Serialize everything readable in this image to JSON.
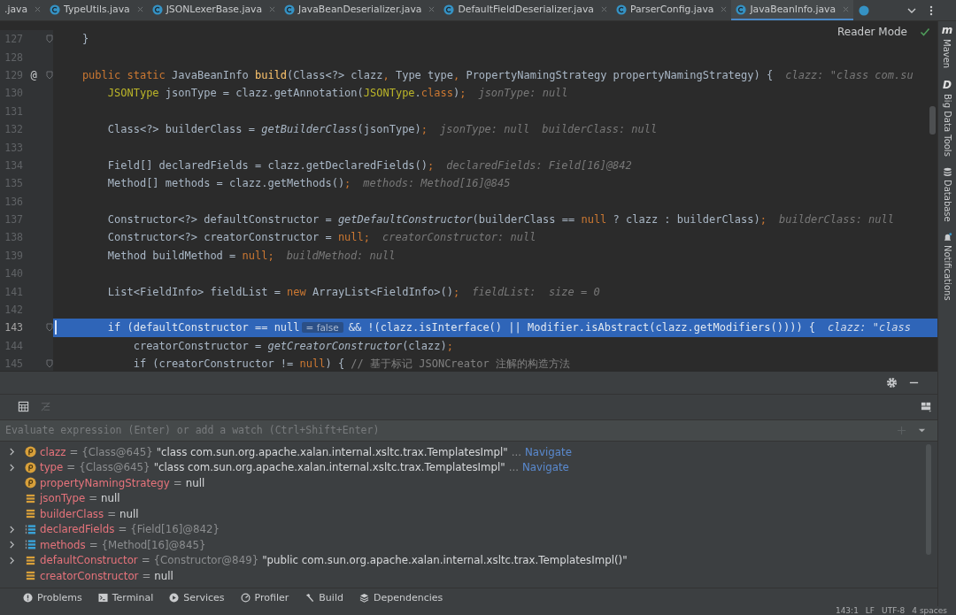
{
  "tabs": [
    {
      "label": ".java",
      "selected": false
    },
    {
      "label": "TypeUtils.java",
      "selected": false
    },
    {
      "label": "JSONLexerBase.java",
      "selected": false
    },
    {
      "label": "JavaBeanDeserializer.java",
      "selected": false
    },
    {
      "label": "DefaultFieldDeserializer.java",
      "selected": false
    },
    {
      "label": "ParserConfig.java",
      "selected": false
    },
    {
      "label": "JavaBeanInfo.java",
      "selected": true
    }
  ],
  "editor": {
    "reader_mode": "Reader Mode",
    "lines": [
      {
        "number": "127",
        "fold": true,
        "selected": false,
        "parts": [
          {
            "kind": "code",
            "tokens": [
              {
                "text": "}",
                "kind": "plain"
              }
            ]
          }
        ]
      },
      {
        "number": "128",
        "fold": false,
        "selected": false
      },
      {
        "number": "129",
        "marker": "@",
        "fold": true,
        "selected": false,
        "parts": [
          {
            "kind": "code",
            "tokens": [
              {
                "text": "public static",
                "kind": "keyword"
              },
              {
                "text": " JavaBeanInfo ",
                "kind": "plain"
              },
              {
                "text": "build",
                "kind": "declaration"
              },
              {
                "text": "(Class<?> clazz",
                "kind": "plain"
              },
              {
                "text": ",",
                "kind": "keyword"
              },
              {
                "text": " Type type",
                "kind": "plain"
              },
              {
                "text": ",",
                "kind": "keyword"
              },
              {
                "text": " PropertyNamingStrategy propertyNamingStrategy) {",
                "kind": "plain"
              }
            ]
          },
          {
            "kind": "hint",
            "text": "clazz: \"class com.su"
          }
        ],
        "children": [
          {
            "number": "130",
            "fold": false,
            "selected": false,
            "parts": [
              {
                "kind": "code",
                "tokens": [
                  {
                    "text": "JSONType",
                    "kind": "annotation"
                  },
                  {
                    "text": " jsonType = clazz.getAnnotation(",
                    "kind": "plain"
                  },
                  {
                    "text": "JSONType",
                    "kind": "annotation"
                  },
                  {
                    "text": ".",
                    "kind": "plain"
                  },
                  {
                    "text": "class",
                    "kind": "keyword"
                  },
                  {
                    "text": ")",
                    "kind": "plain"
                  },
                  {
                    "text": ";",
                    "kind": "keyword"
                  }
                ]
              },
              {
                "kind": "hint",
                "text": "jsonType: null"
              }
            ]
          },
          {
            "number": "131",
            "fold": false,
            "selected": false
          },
          {
            "number": "132",
            "fold": false,
            "selected": false,
            "parts": [
              {
                "kind": "code",
                "tokens": [
                  {
                    "text": "Class<?> builderClass = ",
                    "kind": "plain"
                  },
                  {
                    "text": "getBuilderClass",
                    "kind": "static"
                  },
                  {
                    "text": "(jsonType)",
                    "kind": "plain"
                  },
                  {
                    "text": ";",
                    "kind": "keyword"
                  }
                ]
              },
              {
                "kind": "hint",
                "text": "jsonType: null"
              },
              {
                "kind": "hint",
                "text": "builderClass: null"
              }
            ]
          },
          {
            "number": "133",
            "fold": false,
            "selected": false
          },
          {
            "number": "134",
            "fold": false,
            "selected": false,
            "parts": [
              {
                "kind": "code",
                "tokens": [
                  {
                    "text": "Field[] declaredFields = clazz.getDeclaredFields()",
                    "kind": "plain"
                  },
                  {
                    "text": ";",
                    "kind": "keyword"
                  }
                ]
              },
              {
                "kind": "hint",
                "text": "declaredFields: Field[16]@842"
              }
            ]
          },
          {
            "number": "135",
            "fold": false,
            "selected": false,
            "parts": [
              {
                "kind": "code",
                "tokens": [
                  {
                    "text": "Method[] methods = clazz.getMethods()",
                    "kind": "plain"
                  },
                  {
                    "text": ";",
                    "kind": "keyword"
                  }
                ]
              },
              {
                "kind": "hint",
                "text": "methods: Method[16]@845"
              }
            ]
          },
          {
            "number": "136",
            "fold": false,
            "selected": false
          },
          {
            "number": "137",
            "fold": false,
            "selected": false,
            "parts": [
              {
                "kind": "code",
                "tokens": [
                  {
                    "text": "Constructor<?> defaultConstructor = ",
                    "kind": "plain"
                  },
                  {
                    "text": "getDefaultConstructor",
                    "kind": "static"
                  },
                  {
                    "text": "(builderClass == ",
                    "kind": "plain"
                  },
                  {
                    "text": "null",
                    "kind": "keyword"
                  },
                  {
                    "text": " ? clazz : builderClass)",
                    "kind": "plain"
                  },
                  {
                    "text": ";",
                    "kind": "keyword"
                  }
                ]
              },
              {
                "kind": "hint",
                "text": "builderClass: null"
              }
            ]
          },
          {
            "number": "138",
            "fold": false,
            "selected": false,
            "parts": [
              {
                "kind": "code",
                "tokens": [
                  {
                    "text": "Constructor<?> creatorConstructor = ",
                    "kind": "plain"
                  },
                  {
                    "text": "null;",
                    "kind": "keyword"
                  }
                ]
              },
              {
                "kind": "hint",
                "text": "creatorConstructor: null"
              }
            ]
          },
          {
            "number": "139",
            "fold": false,
            "selected": false,
            "parts": [
              {
                "kind": "code",
                "tokens": [
                  {
                    "text": "Method buildMethod = ",
                    "kind": "plain"
                  },
                  {
                    "text": "null;",
                    "kind": "keyword"
                  }
                ]
              },
              {
                "kind": "hint",
                "text": "buildMethod: null"
              }
            ]
          },
          {
            "number": "140",
            "fold": false,
            "selected": false
          },
          {
            "number": "141",
            "fold": false,
            "selected": false,
            "parts": [
              {
                "kind": "code",
                "tokens": [
                  {
                    "text": "List<FieldInfo> fieldList = ",
                    "kind": "plain"
                  },
                  {
                    "text": "new",
                    "kind": "keyword"
                  },
                  {
                    "text": " ArrayList<FieldInfo>()",
                    "kind": "plain"
                  },
                  {
                    "text": ";",
                    "kind": "keyword"
                  }
                ]
              },
              {
                "kind": "hint",
                "text": "fieldList:  size = 0"
              }
            ]
          },
          {
            "number": "142",
            "fold": false,
            "selected": false
          },
          {
            "number": "143",
            "fold": true,
            "selected": true,
            "parts": [
              {
                "kind": "code",
                "tokens": [
                  {
                    "text": "if (defaultConstructor == null",
                    "kind": "plain"
                  }
                ]
              },
              {
                "kind": "badge",
                "text": "= false"
              },
              {
                "kind": "code",
                "tokens": [
                  {
                    "text": "&& !(clazz.isInterface() || Modifier.isAbstract(clazz.getModifiers()))) {",
                    "kind": "plain"
                  }
                ]
              },
              {
                "kind": "hint",
                "text": "clazz: \"class"
              }
            ],
            "children": [
              {
                "number": "144",
                "fold": false,
                "selected": false,
                "parts": [
                  {
                    "kind": "code",
                    "tokens": [
                      {
                        "text": "creatorConstructor = ",
                        "kind": "plain"
                      },
                      {
                        "text": "getCreatorConstructor",
                        "kind": "static"
                      },
                      {
                        "text": "(clazz)",
                        "kind": "plain"
                      },
                      {
                        "text": ";",
                        "kind": "keyword"
                      }
                    ]
                  }
                ]
              },
              {
                "number": "145",
                "fold": true,
                "selected": false,
                "parts": [
                  {
                    "kind": "code",
                    "tokens": [
                      {
                        "text": "if (creatorConstructor != ",
                        "kind": "plain"
                      },
                      {
                        "text": "null",
                        "kind": "keyword"
                      },
                      {
                        "text": ") { ",
                        "kind": "plain"
                      },
                      {
                        "text": "// 基于标记 JSONCreator 注解的构造方法",
                        "kind": "comment"
                      }
                    ]
                  }
                ]
              }
            ]
          }
        ]
      }
    ]
  },
  "tool_strip": [
    {
      "kind": "glyph",
      "glyph": "m",
      "label": "Maven"
    },
    {
      "kind": "glyph",
      "glyph": "D",
      "label": "Big Data Tools"
    },
    {
      "kind": "database",
      "label": "Database"
    },
    {
      "kind": "bell",
      "label": "Notifications"
    }
  ],
  "debugger": {
    "placeholder": "Evaluate expression (Enter) or add a watch (Ctrl+Shift+Enter)",
    "variables": [
      {
        "name": "clazz",
        "kind": "parameter",
        "expandable": true,
        "assign": "=",
        "ref": "{Class@645}",
        "value": "\"class com.sun.org.apache.xalan.internal.xsltc.trax.TemplatesImpl\"",
        "more": "...",
        "link": "Navigate"
      },
      {
        "name": "type",
        "kind": "parameter",
        "expandable": true,
        "assign": "=",
        "ref": "{Class@645}",
        "value": "\"class com.sun.org.apache.xalan.internal.xsltc.trax.TemplatesImpl\"",
        "more": "...",
        "link": "Navigate"
      },
      {
        "name": "propertyNamingStrategy",
        "kind": "parameter",
        "expandable": false,
        "assign": "=",
        "value": "null"
      },
      {
        "name": "jsonType",
        "kind": "field",
        "expandable": false,
        "assign": "=",
        "value": "null"
      },
      {
        "name": "builderClass",
        "kind": "field",
        "expandable": false,
        "assign": "=",
        "value": "null"
      },
      {
        "name": "declaredFields",
        "kind": "array",
        "expandable": true,
        "assign": "=",
        "ref": "{Field[16]@842}"
      },
      {
        "name": "methods",
        "kind": "array",
        "expandable": true,
        "assign": "=",
        "ref": "{Method[16]@845}"
      },
      {
        "name": "defaultConstructor",
        "kind": "field",
        "expandable": true,
        "assign": "=",
        "ref": "{Constructor@849}",
        "value": "\"public com.sun.org.apache.xalan.internal.xsltc.trax.TemplatesImpl()\""
      },
      {
        "name": "creatorConstructor",
        "kind": "field",
        "expandable": false,
        "assign": "=",
        "value": "null"
      }
    ]
  },
  "tool_windows": [
    {
      "kind": "problems",
      "label": "Problems"
    },
    {
      "kind": "terminal",
      "label": "Terminal"
    },
    {
      "kind": "services",
      "label": "Services"
    },
    {
      "kind": "profiler",
      "label": "Profiler"
    },
    {
      "kind": "build",
      "label": "Build"
    },
    {
      "kind": "dependencies",
      "label": "Dependencies"
    }
  ],
  "status_bar": [
    "143:1",
    "LF",
    "UTF-8",
    "4 spaces"
  ]
}
